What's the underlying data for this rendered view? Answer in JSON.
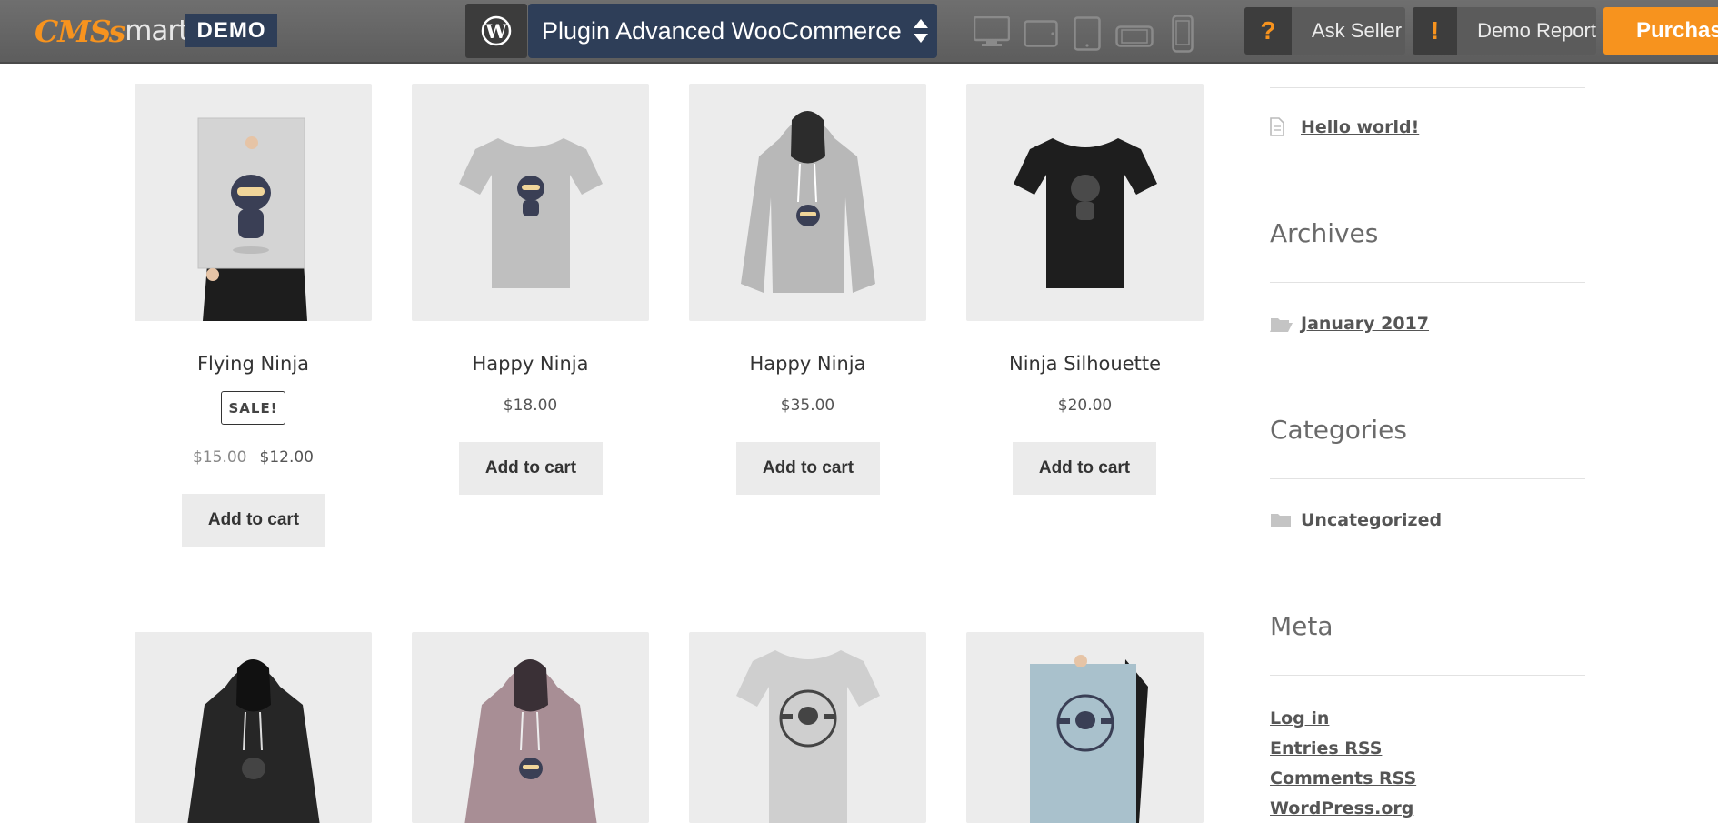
{
  "topbar": {
    "logo_cms": "CMS",
    "logo_smart": "mart",
    "demo_badge": "DEMO",
    "plugin_select_value": "Plugin Advanced WooCommerce",
    "ask_seller_label": "Ask Seller",
    "ask_seller_icon": "?",
    "demo_report_label": "Demo Report",
    "demo_report_icon": "!",
    "purchase_label": "Purchase",
    "accent_color": "#f7931e",
    "badge_color": "#2e3e58"
  },
  "products": [
    {
      "name": "Flying Ninja",
      "sale_badge": "SALE!",
      "old_price": "$15.00",
      "price": "$12.00",
      "cart_label": "Add to cart"
    },
    {
      "name": "Happy Ninja",
      "price": "$18.00",
      "cart_label": "Add to cart"
    },
    {
      "name": "Happy Ninja",
      "price": "$35.00",
      "cart_label": "Add to cart"
    },
    {
      "name": "Ninja Silhouette",
      "price": "$20.00",
      "cart_label": "Add to cart"
    }
  ],
  "sidebar": {
    "recent_post": "Hello world!",
    "archives_heading": "Archives",
    "archive_item": "January 2017",
    "categories_heading": "Categories",
    "category_item": "Uncategorized",
    "meta_heading": "Meta",
    "meta_links": [
      "Log in",
      "Entries RSS",
      "Comments RSS",
      "WordPress.org"
    ]
  }
}
